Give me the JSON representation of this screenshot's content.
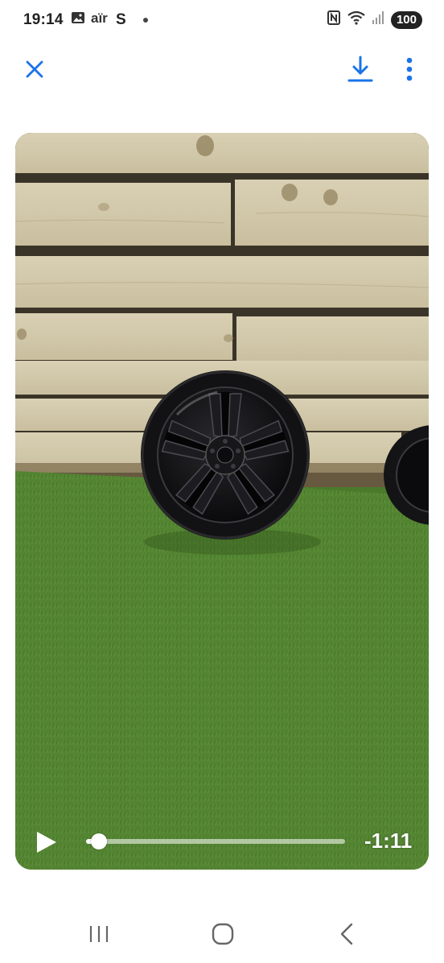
{
  "status_bar": {
    "time": "19:14",
    "carrier_text": "S",
    "battery": "100",
    "icons": [
      "gallery-icon",
      "airtel-icon",
      "nfc-icon",
      "wifi-icon",
      "signal-icon"
    ]
  },
  "app_bar": {
    "close_icon": "close-icon",
    "download_icon": "download-icon",
    "more_icon": "more-vertical-icon",
    "accent_color": "#1a73e8"
  },
  "video": {
    "time_remaining": "-1:11",
    "progress": 0.05,
    "play_icon": "play-icon"
  },
  "nav_bar": {
    "icons": [
      "recents-icon",
      "home-icon",
      "back-icon"
    ]
  }
}
